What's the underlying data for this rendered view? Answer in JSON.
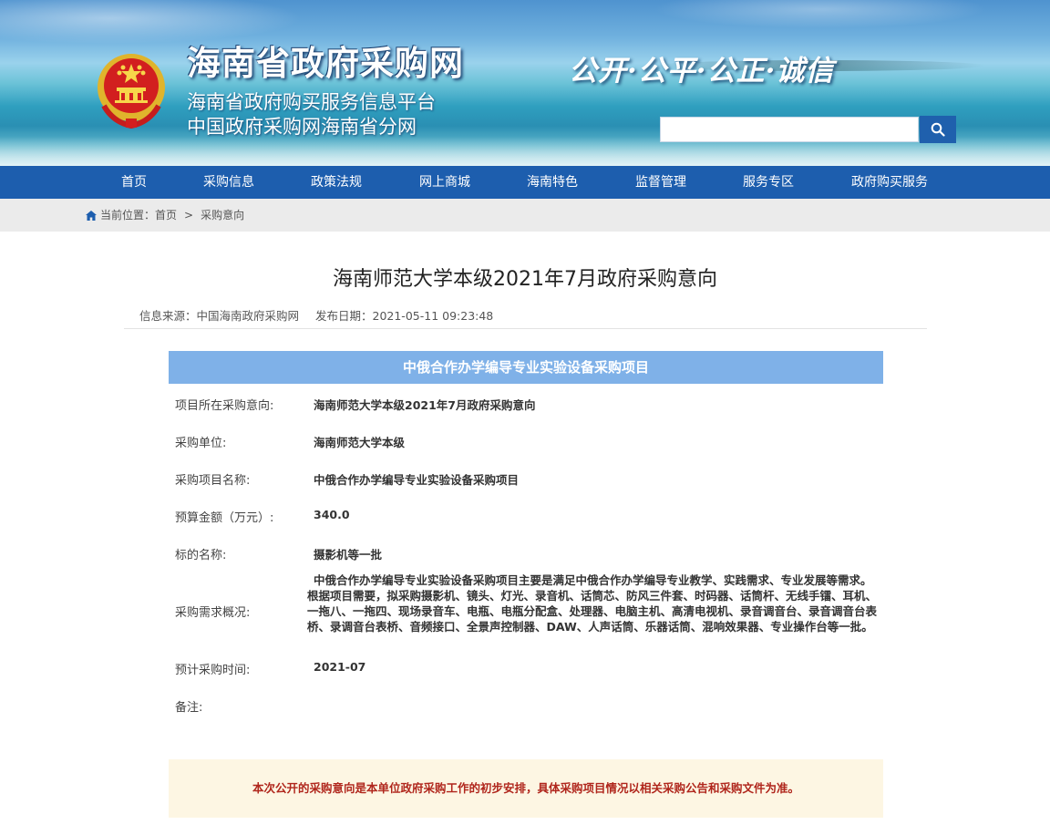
{
  "header": {
    "site_title": "海南省政府采购网",
    "subtitle_1": "海南省政府购买服务信息平台",
    "subtitle_2": "中国政府采购网海南省分网",
    "slogan": "公开·公平·公正·诚信",
    "search": {
      "value": "",
      "placeholder": ""
    },
    "search_icon": "search-icon"
  },
  "nav": {
    "items": [
      {
        "label": "首页"
      },
      {
        "label": "采购信息"
      },
      {
        "label": "政策法规"
      },
      {
        "label": "网上商城"
      },
      {
        "label": "海南特色"
      },
      {
        "label": "监督管理"
      },
      {
        "label": "服务专区"
      },
      {
        "label": "政府购买服务"
      }
    ]
  },
  "breadcrumb": {
    "icon": "home-icon",
    "prefix": "当前位置：",
    "home": "首页",
    "separator": ">",
    "current": "采购意向"
  },
  "article": {
    "title": "海南师范大学本级2021年7月政府采购意向",
    "source": "信息来源：中国海南政府采购网",
    "publish_date": "发布日期：2021-05-11 09:23:48"
  },
  "project": {
    "heading": "中俄合作办学编导专业实验设备采购项目",
    "rows": [
      {
        "label": "项目所在采购意向:",
        "value": "海南师范大学本级2021年7月政府采购意向"
      },
      {
        "label": "采购单位:",
        "value": "海南师范大学本级"
      },
      {
        "label": "采购项目名称:",
        "value": "中俄合作办学编导专业实验设备采购项目"
      },
      {
        "label": "预算金额（万元）:",
        "value": "340.0"
      },
      {
        "label": "标的名称:",
        "value": "摄影机等一批"
      },
      {
        "label": "采购需求概况:",
        "value": "中俄合作办学编导专业实验设备采购项目主要是满足中俄合作办学编导专业教学、实践需求、专业发展等需求。根据项目需要，拟采购摄影机、镜头、灯光、录音机、话筒芯、防风三件套、时码器、话筒杆、无线手镭、耳机、一拖八、一拖四、现场录音车、电瓶、电瓶分配盒、处理器、电脑主机、高清电视机、录音调音台、录音调音台表桥、录调音台表桥、音频接口、全景声控制器、DAW、人声话筒、乐器话筒、混响效果器、专业操作台等一批。"
      },
      {
        "label": "预计采购时间:",
        "value": "2021-07"
      },
      {
        "label": "备注:",
        "value": ""
      }
    ]
  },
  "notice": "本次公开的采购意向是本单位政府采购工作的初步安排，具体采购项目情况以相关采购公告和采购文件为准。",
  "colors": {
    "nav_bg": "#1d5eae",
    "project_heading_bg": "#7fb1e8",
    "notice_bg": "#fdf6e3",
    "notice_text": "#b0261c"
  }
}
